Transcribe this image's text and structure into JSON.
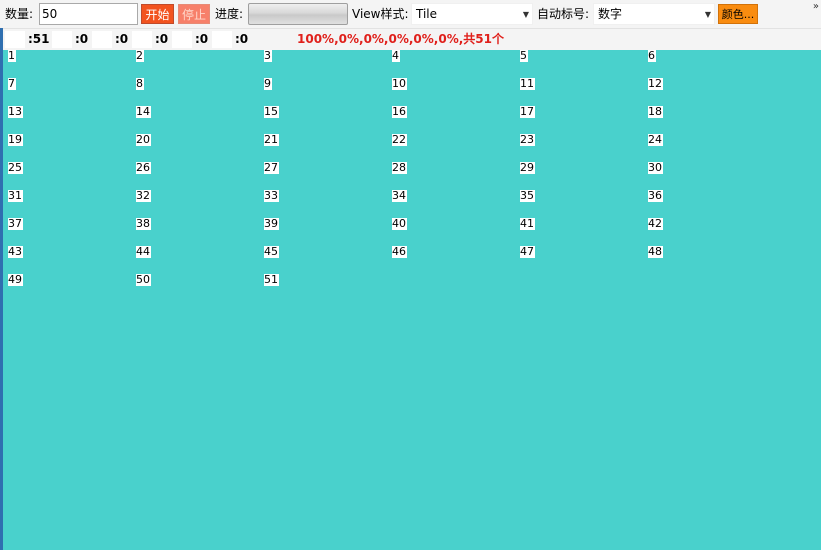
{
  "toolbar": {
    "count_label": "数量:",
    "count_value": "50",
    "start_label": "开始",
    "stop_label": "停止",
    "progress_label": "进度:",
    "progress_value": 0,
    "view_style_label": "View样式:",
    "view_style_value": "Tile",
    "auto_label_label": "自动标号:",
    "auto_label_value": "数字",
    "color_label": "颜色...",
    "overflow_icon": "double-chevron-right-icon"
  },
  "statusbar": {
    "values": [
      ":51",
      ":0",
      ":0",
      ":0",
      ":0",
      ":0"
    ],
    "summary": "100%,0%,0%,0%,0%,0%,共51个"
  },
  "listview": {
    "background_color": "#49d1cc",
    "items": [
      "1",
      "2",
      "3",
      "4",
      "5",
      "6",
      "7",
      "8",
      "9",
      "10",
      "11",
      "12",
      "13",
      "14",
      "15",
      "16",
      "17",
      "18",
      "19",
      "20",
      "21",
      "22",
      "23",
      "24",
      "25",
      "26",
      "27",
      "28",
      "29",
      "30",
      "31",
      "32",
      "33",
      "34",
      "35",
      "36",
      "37",
      "38",
      "39",
      "40",
      "41",
      "42",
      "43",
      "44",
      "45",
      "46",
      "47",
      "48",
      "49",
      "50",
      "51"
    ]
  },
  "colors": {
    "start_button": "#f2531f",
    "stop_button": "#f7806a",
    "color_button": "#f98c10",
    "status_text": "#e0201b"
  }
}
